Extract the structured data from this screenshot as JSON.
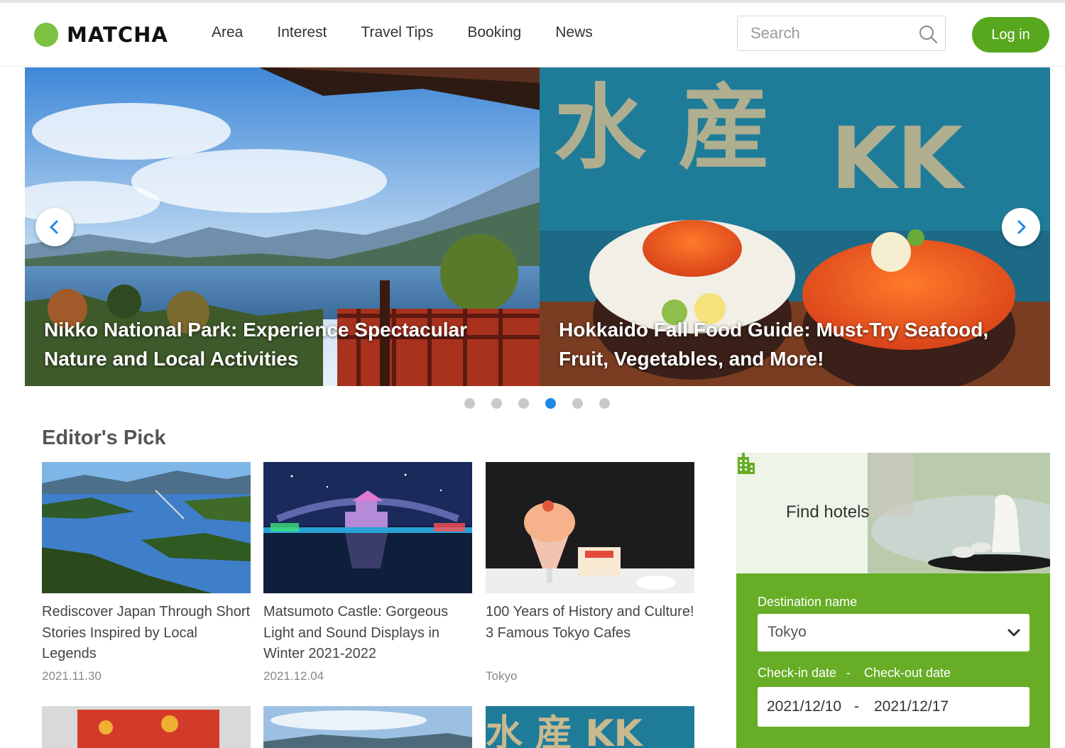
{
  "brand": {
    "name": "MATCHA",
    "color": "#7cc242"
  },
  "nav": {
    "items": [
      "Area",
      "Interest",
      "Travel Tips",
      "Booking",
      "News"
    ]
  },
  "search": {
    "placeholder": "Search"
  },
  "login": {
    "label": "Log in",
    "color": "#58a81e"
  },
  "hero": {
    "slides": [
      {
        "title": "Nikko National Park: Experience Spectacular Nature and Local Activities"
      },
      {
        "title": "Hokkaido Fall Food Guide: Must-Try Seafood, Fruit, Vegetables, and More!"
      }
    ],
    "dots_total": 6,
    "active_dot": 4,
    "active_color": "#1e88e5"
  },
  "editors_pick": {
    "title": "Editor's Pick",
    "cards": [
      {
        "title": "Rediscover Japan Through Short Stories Inspired by Local Legends",
        "meta": "2021.11.30"
      },
      {
        "title": "Matsumoto Castle: Gorgeous Light and Sound Displays in Winter 2021-2022",
        "meta": "2021.12.04"
      },
      {
        "title": "100 Years of History and Culture! 3 Famous Tokyo Cafes",
        "meta": "Tokyo"
      }
    ]
  },
  "hotels": {
    "heading": "Find hotels",
    "destination_label": "Destination name",
    "destination_value": "Tokyo",
    "checkin_label": "Check-in date",
    "separator": "-",
    "checkout_label": "Check-out date",
    "checkin_value": "2021/12/10",
    "checkout_value": "2021/12/17",
    "panel_color": "#67ad26"
  }
}
